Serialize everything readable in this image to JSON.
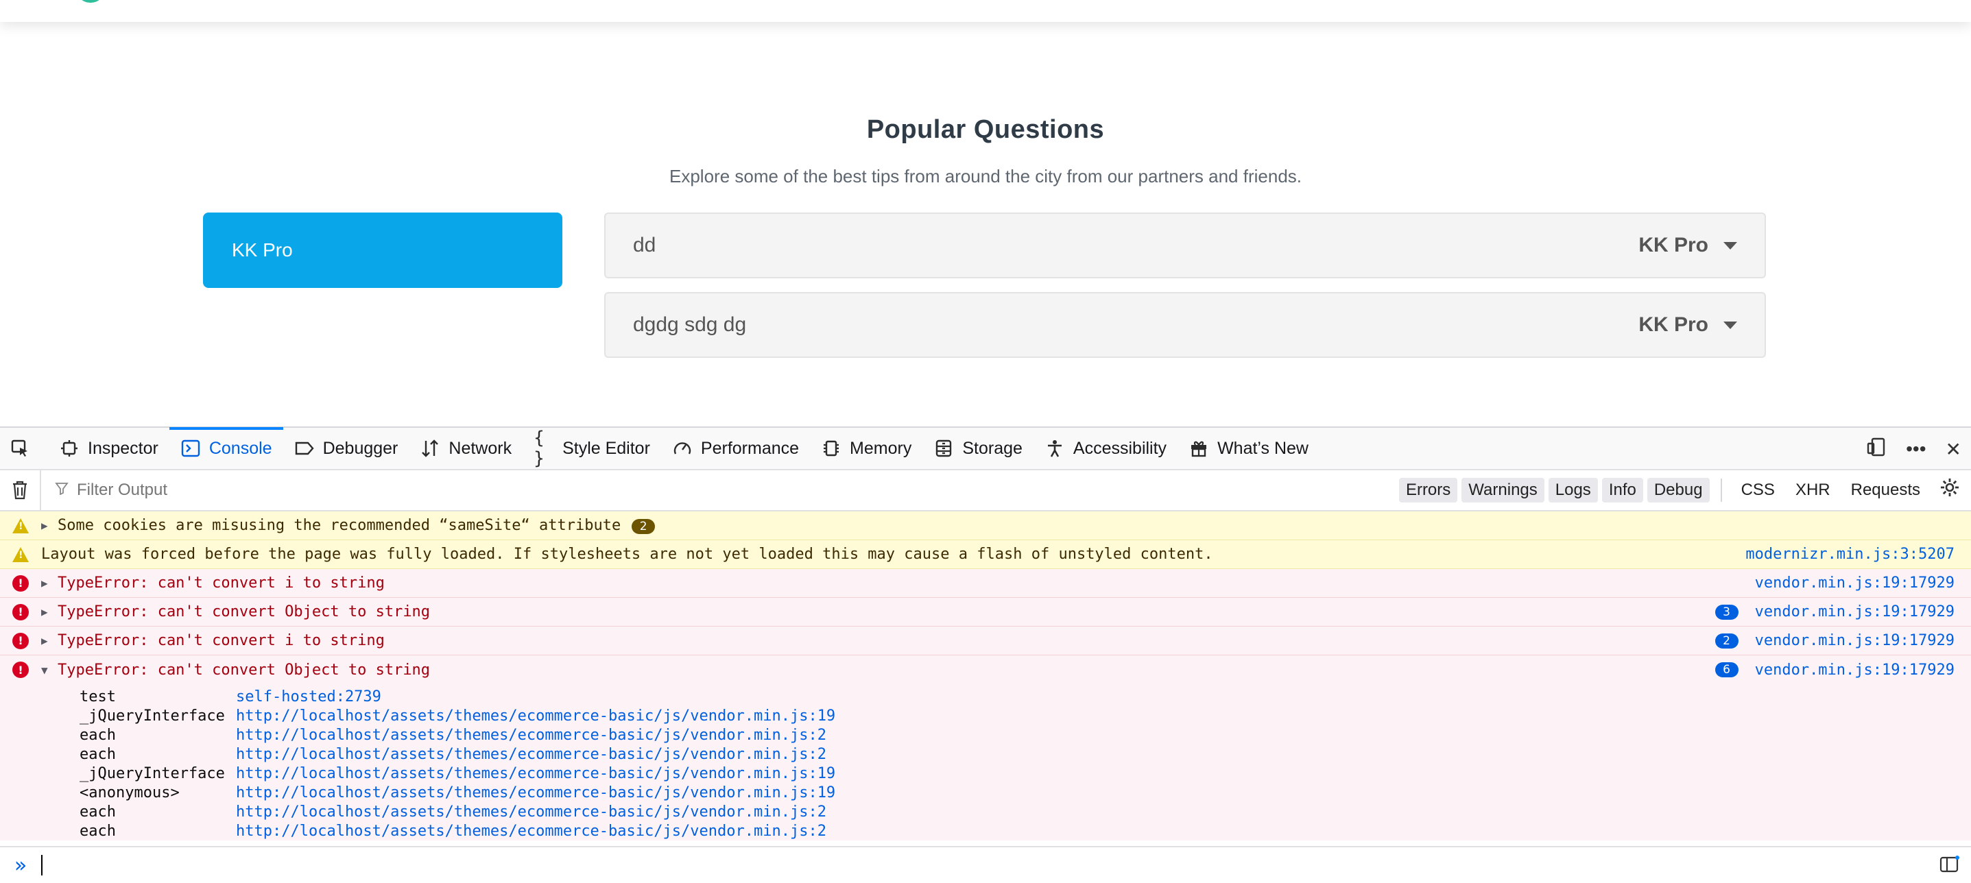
{
  "page": {
    "title": "Popular Questions",
    "subtitle": "Explore some of the best tips from around the city from our partners and friends.",
    "category_button": "KK Pro",
    "faqs": [
      {
        "question": "dd",
        "tag": "KK Pro"
      },
      {
        "question": "dgdg sdg dg",
        "tag": "KK Pro"
      }
    ]
  },
  "devtools": {
    "tabs": [
      {
        "label": "Inspector",
        "icon": "inspector-icon"
      },
      {
        "label": "Console",
        "icon": "console-icon",
        "active": true
      },
      {
        "label": "Debugger",
        "icon": "debugger-icon"
      },
      {
        "label": "Network",
        "icon": "network-icon"
      },
      {
        "label": "Style Editor",
        "icon": "style-editor-icon"
      },
      {
        "label": "Performance",
        "icon": "performance-icon"
      },
      {
        "label": "Memory",
        "icon": "memory-icon"
      },
      {
        "label": "Storage",
        "icon": "storage-icon"
      },
      {
        "label": "Accessibility",
        "icon": "accessibility-icon"
      },
      {
        "label": "What’s New",
        "icon": "gift-icon"
      }
    ],
    "filter_placeholder": "Filter Output",
    "filter_buttons": [
      "Errors",
      "Warnings",
      "Logs",
      "Info",
      "Debug"
    ],
    "extra_filters": [
      "CSS",
      "XHR",
      "Requests"
    ],
    "messages": [
      {
        "level": "warning",
        "expandable": true,
        "text": "Some cookies are misusing the recommended “sameSite“ attribute",
        "badge": "2",
        "source": ""
      },
      {
        "level": "warning",
        "expandable": false,
        "text": "Layout was forced before the page was fully loaded. If stylesheets are not yet loaded this may cause a flash of unstyled content.",
        "badge": "",
        "source": "modernizr.min.js:3:5207"
      },
      {
        "level": "error",
        "expandable": true,
        "text": "TypeError: can't convert i to string",
        "badge": "",
        "source": "vendor.min.js:19:17929"
      },
      {
        "level": "error",
        "expandable": true,
        "text": "TypeError: can't convert Object to string",
        "badge": "3",
        "source": "vendor.min.js:19:17929"
      },
      {
        "level": "error",
        "expandable": true,
        "text": "TypeError: can't convert i to string",
        "badge": "2",
        "source": "vendor.min.js:19:17929"
      },
      {
        "level": "error",
        "expandable": true,
        "expanded": true,
        "text": "TypeError: can't convert Object to string",
        "badge": "6",
        "source": "vendor.min.js:19:17929"
      }
    ],
    "stack": [
      {
        "fn": "test",
        "loc": "self-hosted:2739"
      },
      {
        "fn": "_jQueryInterface",
        "loc": "http://localhost/assets/themes/ecommerce-basic/js/vendor.min.js:19"
      },
      {
        "fn": "each",
        "loc": "http://localhost/assets/themes/ecommerce-basic/js/vendor.min.js:2"
      },
      {
        "fn": "each",
        "loc": "http://localhost/assets/themes/ecommerce-basic/js/vendor.min.js:2"
      },
      {
        "fn": "_jQueryInterface",
        "loc": "http://localhost/assets/themes/ecommerce-basic/js/vendor.min.js:19"
      },
      {
        "fn": "<anonymous>",
        "loc": "http://localhost/assets/themes/ecommerce-basic/js/vendor.min.js:19"
      },
      {
        "fn": "each",
        "loc": "http://localhost/assets/themes/ecommerce-basic/js/vendor.min.js:2"
      },
      {
        "fn": "each",
        "loc": "http://localhost/assets/themes/ecommerce-basic/js/vendor.min.js:2"
      }
    ]
  }
}
